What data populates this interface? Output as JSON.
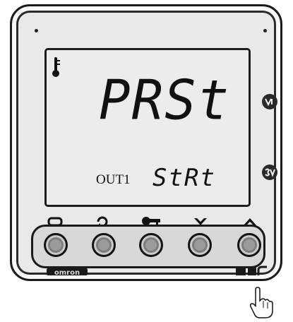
{
  "display": {
    "pv_value": "PRSt",
    "output_label": "OUT1",
    "sv_value": "StRt"
  },
  "indicators": {
    "pv_badge_icon": "pv-indicator-icon",
    "sv_badge_icon": "sv-indicator-icon",
    "thermometer_icon": "thermometer-icon"
  },
  "keys": [
    {
      "name": "level-key",
      "icon": "level-icon"
    },
    {
      "name": "mode-key",
      "icon": "cycle-arrow-icon"
    },
    {
      "name": "protect-key",
      "icon": "key-icon"
    },
    {
      "name": "down-key",
      "icon": "chevron-down-icon"
    },
    {
      "name": "up-key",
      "icon": "chevron-up-icon"
    }
  ],
  "brand": {
    "logo_text": "omron"
  },
  "colors": {
    "lcd_background": "#ececec",
    "bezel": "#e9e9e9",
    "outline": "#1a1a1a",
    "key_fill": "#9b9b9b"
  }
}
